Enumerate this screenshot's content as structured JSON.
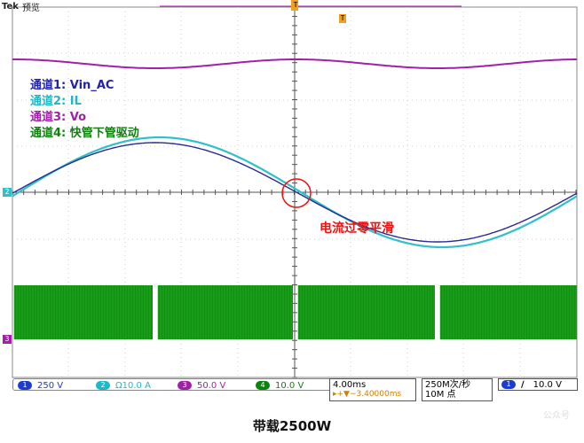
{
  "header": {
    "brand": "Tek",
    "mode": "预览"
  },
  "markers": {
    "trigger_top": "T",
    "ch2": "2",
    "ch3": "3"
  },
  "legend": [
    {
      "label": "通道1: Vin_AC",
      "color": "#2222aa"
    },
    {
      "label": "通道2: IL",
      "color": "#20b8c8"
    },
    {
      "label": "通道3: Vo",
      "color": "#a020a8"
    },
    {
      "label": "通道4: 快管下管驱动",
      "color": "#108010"
    }
  ],
  "annotation": "电流过零平滑",
  "status": {
    "ch1": {
      "num": "1",
      "scale": "250 V",
      "color": "#1a3ccf"
    },
    "ch2": {
      "num": "2",
      "scale": "Ω10.0 A",
      "color": "#20b8c8"
    },
    "ch3": {
      "num": "3",
      "scale": "50.0 V",
      "color": "#a020a8"
    },
    "ch4": {
      "num": "4",
      "scale": "10.0 V",
      "color": "#108010"
    },
    "timebase": "4.00ms",
    "delay": "▸+▼−3.40000ms",
    "samplerate": "250M次/秒",
    "recordlen": "10M 点",
    "trig_source": "1",
    "trig_slope": "∕",
    "trig_level": "10.0 V"
  },
  "caption": "带载2500W",
  "watermark": "公众号"
}
